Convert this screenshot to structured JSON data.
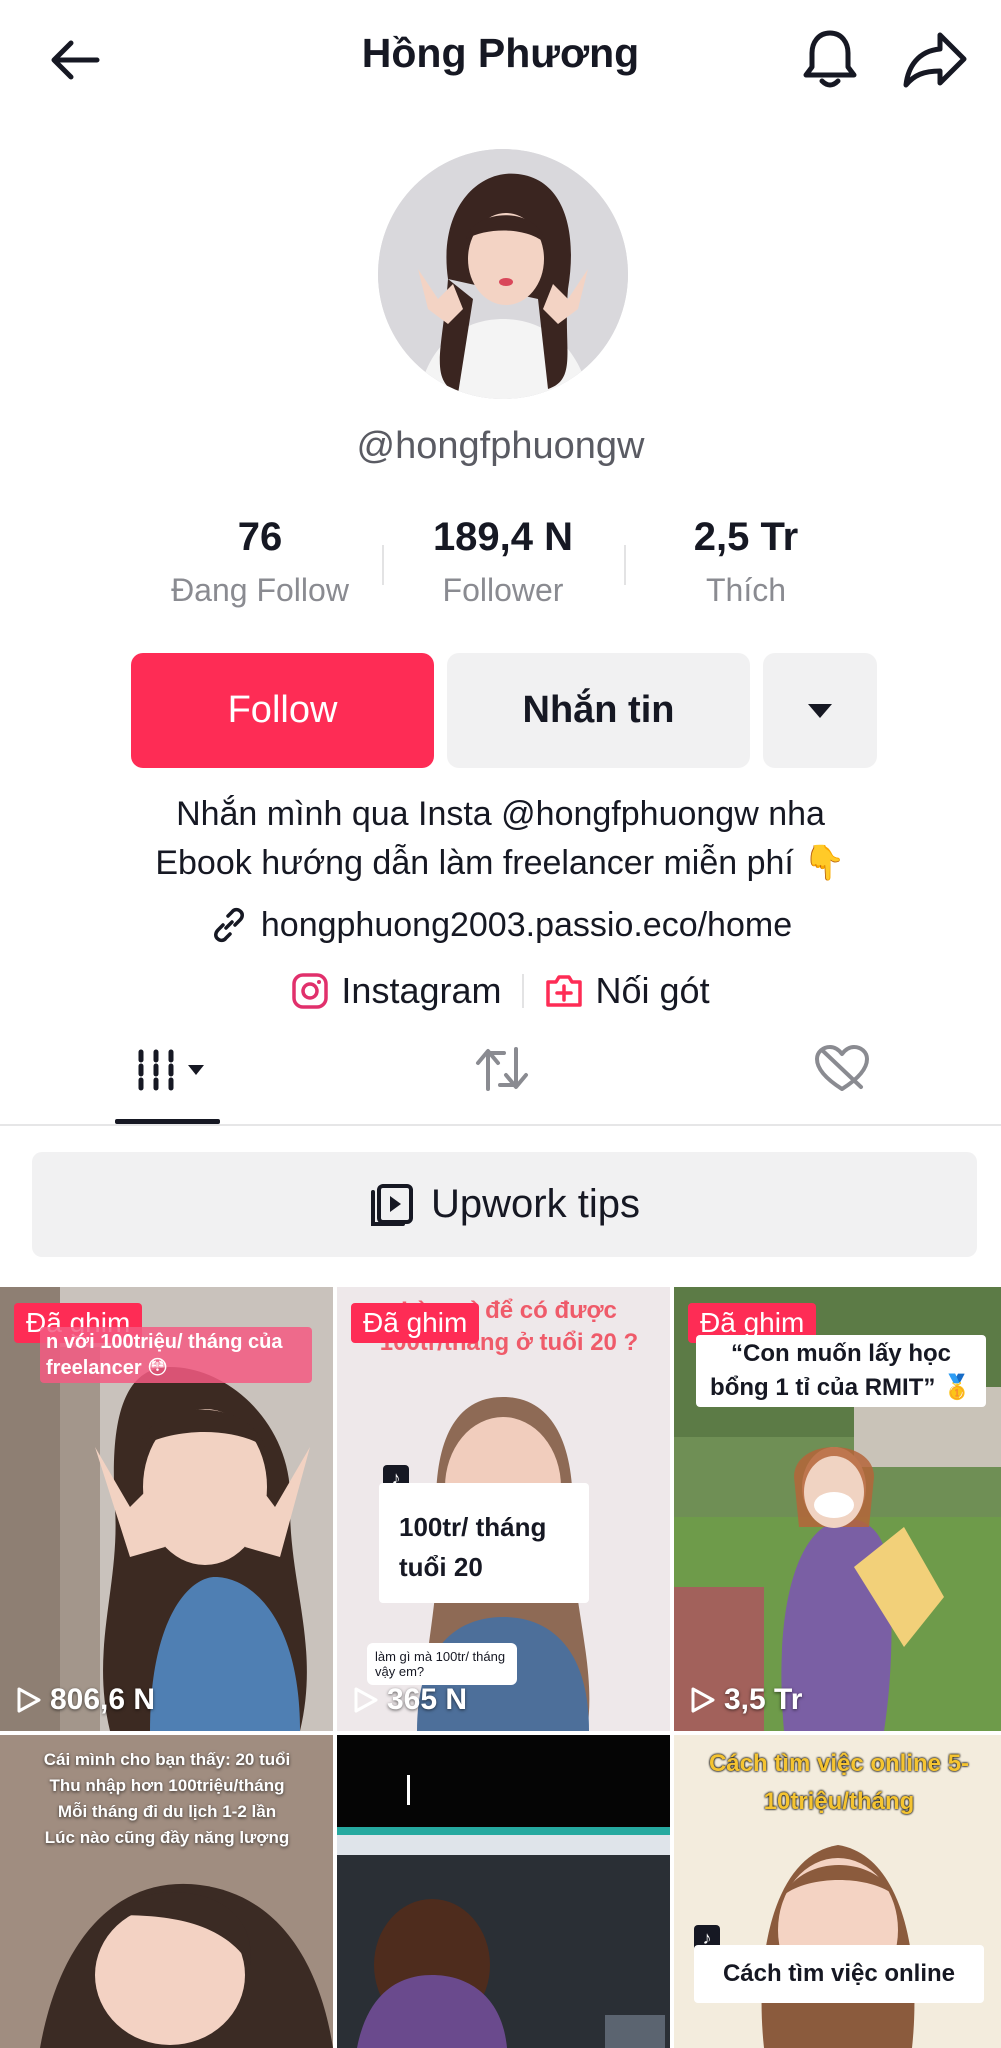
{
  "header": {
    "title": "Hồng Phương"
  },
  "profile": {
    "username": "@hongfphuongw"
  },
  "stats": [
    {
      "value": "76",
      "label": "Đang Follow"
    },
    {
      "value": "189,4 N",
      "label": "Follower"
    },
    {
      "value": "2,5 Tr",
      "label": "Thích"
    }
  ],
  "actions": {
    "follow": "Follow",
    "message": "Nhắn tin"
  },
  "bio": {
    "line1": "Nhắn mình qua Insta @hongfphuongw nha",
    "line2": "Ebook hướng dẫn làm freelancer miễn phí 👇",
    "link": "hongphuong2003.passio.eco/home"
  },
  "social": {
    "instagram": "Instagram",
    "connect": "Nối gót"
  },
  "playlist": {
    "label": "Upwork tips"
  },
  "colors": {
    "accent": "#fe2c55",
    "button_gray": "#f1f1f2",
    "text": "#161823"
  },
  "videos": [
    {
      "pinned": "Đã ghim",
      "views": "806,6 N",
      "caption": "n với 100triệu/ tháng của freelancer 😳"
    },
    {
      "pinned": "Đã ghim",
      "views": "365 N",
      "caption": "Làm gì để có được 100tr/tháng ở tuổi 20 ?",
      "card": "100tr/ tháng tuổi 20",
      "reply": "làm gì mà 100tr/ tháng vậy em?"
    },
    {
      "pinned": "Đã ghim",
      "views": "3,5 Tr",
      "caption": "“Con muốn lấy học bổng 1 tỉ của RMIT” 🥇"
    },
    {
      "caption": "Cái mình cho bạn thấy: 20 tuổi Thu nhập hơn 100triệu/tháng Mỗi tháng đi du lịch 1-2 lần Lúc nào cũng đầy năng lượng"
    },
    {
      "caption": ""
    },
    {
      "caption": "Cách tìm việc online 5-10triệu/tháng",
      "card": "Cách tìm việc online"
    }
  ]
}
